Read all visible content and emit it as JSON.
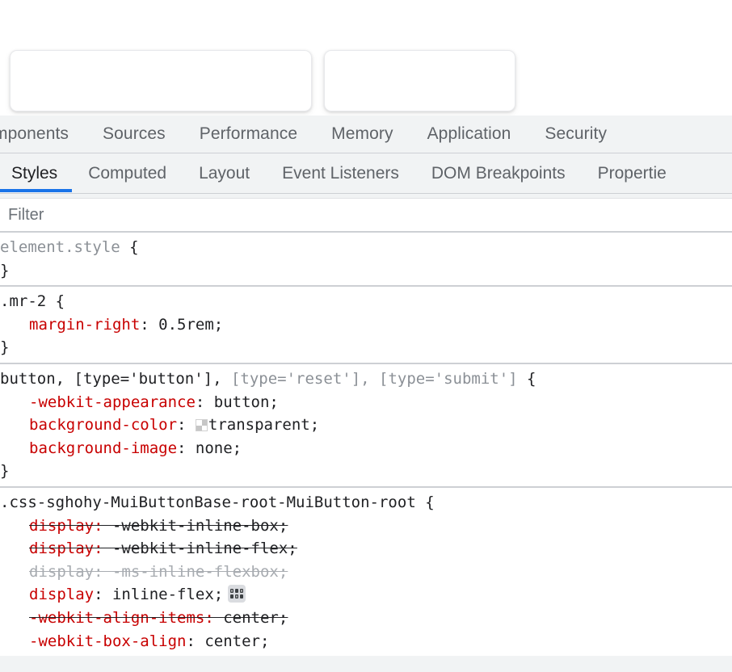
{
  "page": {
    "cards": [
      {
        "name": "card-left",
        "label": ""
      },
      {
        "name": "card-right",
        "label": ""
      }
    ]
  },
  "devtools": {
    "main_tabs": [
      {
        "label": "mponents",
        "active": false
      },
      {
        "label": "Sources",
        "active": false
      },
      {
        "label": "Performance",
        "active": false
      },
      {
        "label": "Memory",
        "active": false
      },
      {
        "label": "Application",
        "active": false
      },
      {
        "label": "Security",
        "active": false
      }
    ],
    "sidebar_tabs": [
      {
        "label": "Styles",
        "active": true
      },
      {
        "label": "Computed",
        "active": false
      },
      {
        "label": "Layout",
        "active": false
      },
      {
        "label": "Event Listeners",
        "active": false
      },
      {
        "label": "DOM Breakpoints",
        "active": false
      },
      {
        "label": "Propertie",
        "active": false
      }
    ],
    "accent_color": "#1a73e8",
    "filter": {
      "placeholder": "Filter",
      "value": ""
    },
    "rules": [
      {
        "selector_open": "element.style {",
        "selector_text": "element.style",
        "close": "}",
        "declarations": []
      },
      {
        "selector_open": ".mr-2 {",
        "selector_text": ".mr-2",
        "close": "}",
        "declarations": [
          {
            "property": "margin-right",
            "value": "0.5rem;",
            "state": "active"
          }
        ]
      },
      {
        "selector_open": "button, [type='button'], [type='reset'], [type='submit'] {",
        "selector_matched": "button, [type='button'],",
        "selector_unmatched": " [type='reset'], [type='submit']",
        "close": "}",
        "declarations": [
          {
            "property": "-webkit-appearance",
            "value": "button;",
            "state": "active"
          },
          {
            "property": "background-color",
            "value": "transparent;",
            "state": "active",
            "swatch": "transparent"
          },
          {
            "property": "background-image",
            "value": "none;",
            "state": "active"
          }
        ]
      },
      {
        "selector_open": ".css-sghohy-MuiButtonBase-root-MuiButton-root {",
        "selector_text": ".css-sghohy-MuiButtonBase-root-MuiButton-root",
        "close": "",
        "declarations": [
          {
            "property": "display",
            "value": "-webkit-inline-box;",
            "state": "struck-red"
          },
          {
            "property": "display",
            "value": "-webkit-inline-flex;",
            "state": "struck-red"
          },
          {
            "property": "display",
            "value": "-ms-inline-flexbox;",
            "state": "struck-grey"
          },
          {
            "property": "display",
            "value": "inline-flex;",
            "state": "active",
            "icon": "flexbox-editor-icon"
          },
          {
            "property": "-webkit-align-items",
            "value": "center;",
            "state": "struck-red"
          },
          {
            "property": "-webkit-box-align",
            "value": "center;",
            "state": "active"
          }
        ]
      }
    ]
  }
}
